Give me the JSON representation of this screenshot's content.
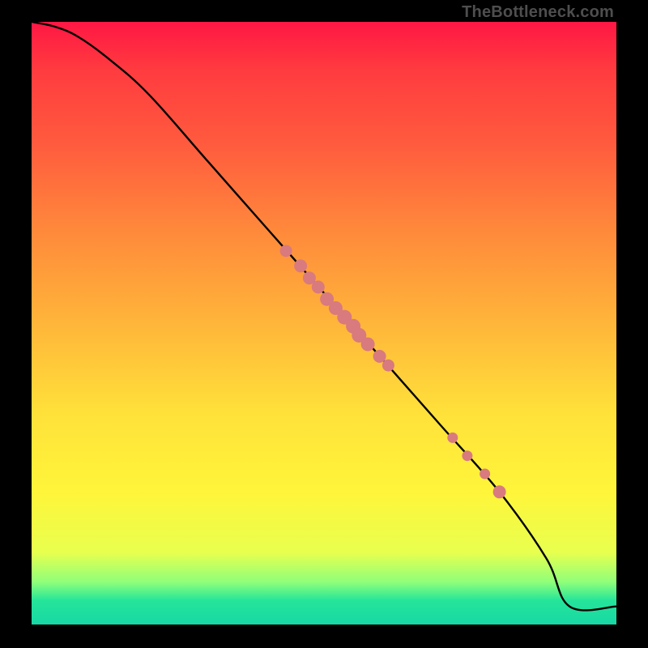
{
  "watermark": "TheBottleneck.com",
  "colors": {
    "dot": "#d87a7e",
    "curve": "#000000"
  },
  "chart_data": {
    "type": "line",
    "title": "",
    "xlabel": "",
    "ylabel": "",
    "xlim": [
      0,
      100
    ],
    "ylim": [
      0,
      100
    ],
    "grid": false,
    "legend": false,
    "series": [
      {
        "name": "curve",
        "kind": "line",
        "x": [
          0,
          4,
          8,
          13,
          20,
          30,
          40,
          50,
          60,
          70,
          80,
          88,
          92,
          100
        ],
        "y": [
          100,
          99.2,
          97.5,
          94,
          88,
          77,
          66,
          55,
          44,
          33,
          22,
          11,
          3,
          3
        ]
      },
      {
        "name": "points",
        "kind": "scatter",
        "x": [
          43.5,
          46,
          47.5,
          49,
          50.5,
          52,
          53.5,
          55,
          56,
          57.5,
          59.5,
          61,
          72,
          74.5,
          77.5,
          80
        ],
        "y": [
          62,
          59.5,
          57.5,
          56,
          54,
          52.5,
          51,
          49.5,
          48,
          46.5,
          44.5,
          43,
          31,
          28,
          25,
          22
        ],
        "r": [
          7.5,
          8,
          8,
          8,
          8.5,
          8.5,
          9,
          9,
          9,
          8.5,
          8,
          7.5,
          6.5,
          6.5,
          6.5,
          8
        ]
      }
    ]
  }
}
